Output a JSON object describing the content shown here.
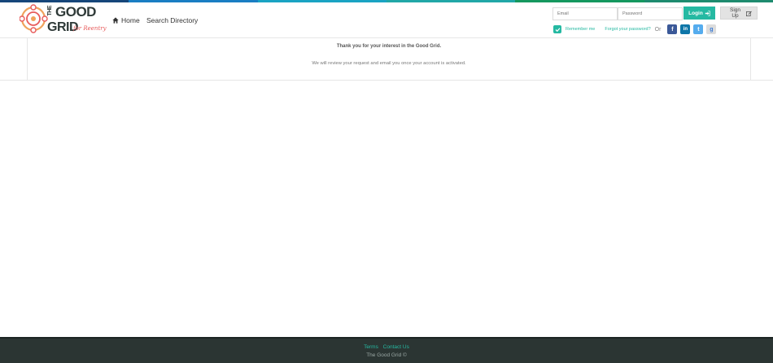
{
  "colors": {
    "accent": "#25b9a2",
    "topbar": [
      "#16467a",
      "#1a7ec3",
      "#1aa3c3",
      "#21a7a7",
      "#15985f",
      "#1e8b6f"
    ],
    "footer_bg": "#2b3533"
  },
  "brand": {
    "line1": "THE",
    "line2": "GOOD",
    "line3": "GRID",
    "tagline": "for Reentry"
  },
  "nav": {
    "home_label": "Home",
    "home_icon": "home-icon",
    "search_label": "Search Directory"
  },
  "login": {
    "email_placeholder": "Email",
    "password_placeholder": "Password",
    "login_label": "Login",
    "login_icon": "sign-in-icon",
    "signup_label": "Sign Up",
    "signup_icon": "edit-icon",
    "remember_label": "Remember me",
    "remember_checked": true,
    "forgot_label": "Forgot your password?",
    "or_label": "Or",
    "social": [
      "facebook-icon",
      "linkedin-icon",
      "twitter-icon",
      "google-icon"
    ]
  },
  "message": {
    "title": "Thank you for your interest in the Good Grid.",
    "body": "We will review your request and email you once your account is activated."
  },
  "footer": {
    "terms_label": "Terms",
    "contact_label": "Contact Us",
    "copyright": "The Good Grid ©"
  }
}
